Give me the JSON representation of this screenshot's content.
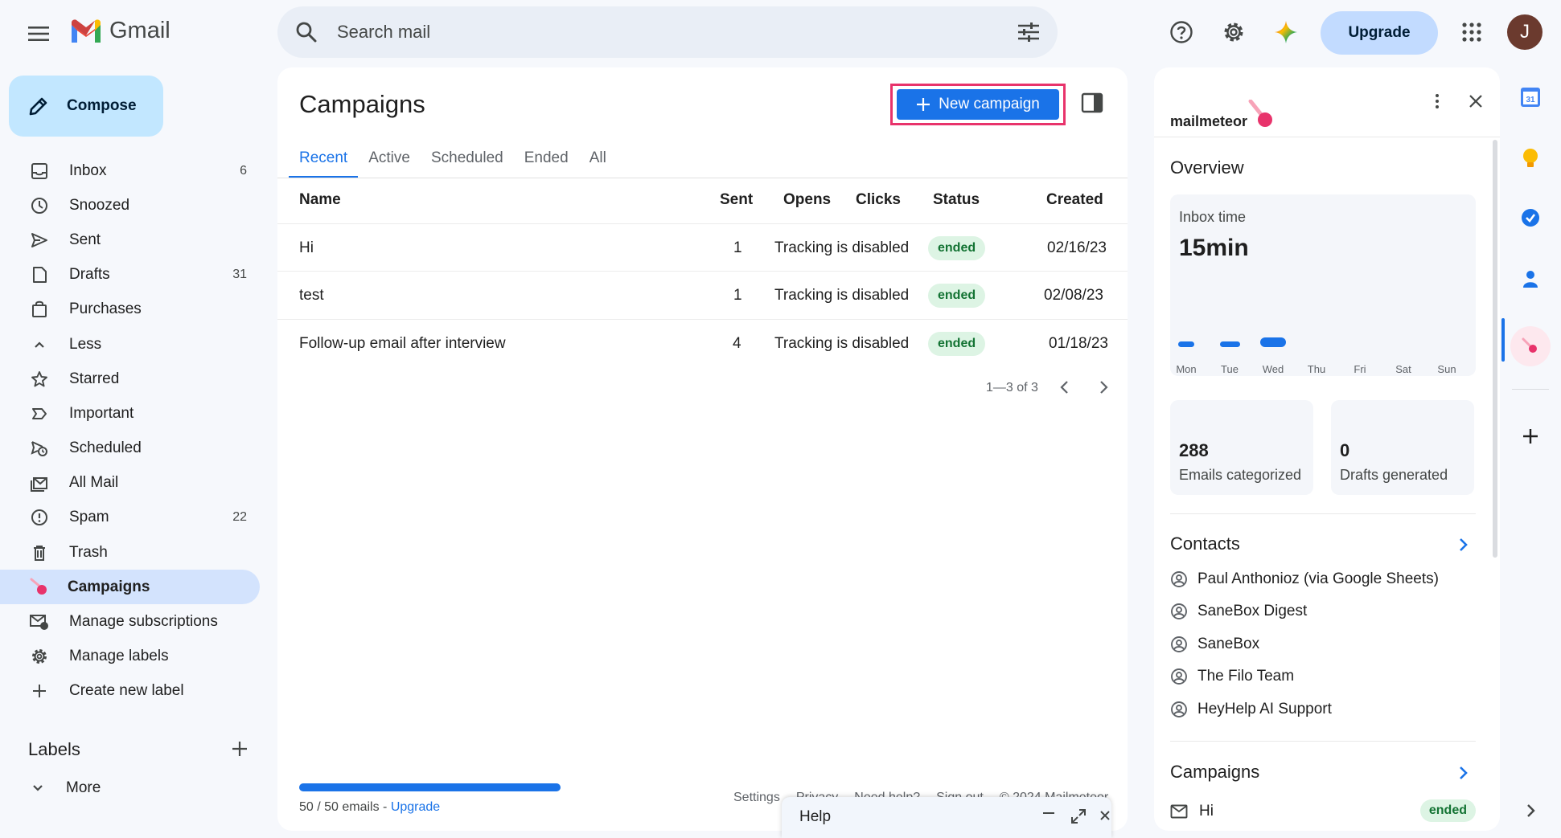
{
  "app": {
    "name": "Gmail",
    "search_placeholder": "Search mail",
    "upgrade_label": "Upgrade",
    "avatar_initial": "J"
  },
  "sidebar": {
    "compose_label": "Compose",
    "items": [
      {
        "label": "Inbox",
        "count": "6",
        "icon": "inbox-icon",
        "bold": true
      },
      {
        "label": "Snoozed",
        "count": "",
        "icon": "clock-icon",
        "bold": false
      },
      {
        "label": "Sent",
        "count": "",
        "icon": "send-icon",
        "bold": false
      },
      {
        "label": "Drafts",
        "count": "31",
        "icon": "draft-icon",
        "bold": true
      },
      {
        "label": "Purchases",
        "count": "",
        "icon": "shopping-bag-icon",
        "bold": false
      },
      {
        "label": "Less",
        "count": "",
        "icon": "chevron-up-icon",
        "bold": false
      },
      {
        "label": "Starred",
        "count": "",
        "icon": "star-icon",
        "bold": false
      },
      {
        "label": "Important",
        "count": "",
        "icon": "important-icon",
        "bold": false
      },
      {
        "label": "Scheduled",
        "count": "",
        "icon": "scheduled-send-icon",
        "bold": false
      },
      {
        "label": "All Mail",
        "count": "",
        "icon": "all-mail-icon",
        "bold": false
      },
      {
        "label": "Spam",
        "count": "22",
        "icon": "spam-icon",
        "bold": true
      },
      {
        "label": "Trash",
        "count": "",
        "icon": "trash-icon",
        "bold": false
      },
      {
        "label": "Campaigns",
        "count": "",
        "icon": "mailmeteor-icon",
        "bold": true
      },
      {
        "label": "Manage subscriptions",
        "count": "",
        "icon": "manage-subscriptions-icon",
        "bold": false
      },
      {
        "label": "Manage labels",
        "count": "",
        "icon": "gear-icon",
        "bold": false
      },
      {
        "label": "Create new label",
        "count": "",
        "icon": "plus-icon",
        "bold": false
      }
    ],
    "labels_heading": "Labels",
    "more_label": "More"
  },
  "main": {
    "title": "Campaigns",
    "new_campaign_label": "New campaign",
    "tabs": [
      "Recent",
      "Active",
      "Scheduled",
      "Ended",
      "All"
    ],
    "columns": {
      "name": "Name",
      "sent": "Sent",
      "opens": "Opens",
      "clicks": "Clicks",
      "status": "Status",
      "created": "Created"
    },
    "rows": [
      {
        "name": "Hi",
        "sent": "1",
        "tracking": "Tracking is disabled",
        "status": "ended",
        "created": "02/16/23"
      },
      {
        "name": "test",
        "sent": "1",
        "tracking": "Tracking is disabled",
        "status": "ended",
        "created": "02/08/23"
      },
      {
        "name": "Follow-up email after interview",
        "sent": "4",
        "tracking": "Tracking is disabled",
        "status": "ended",
        "created": "01/18/23"
      }
    ],
    "pagination": "1—3 of 3",
    "quota_text": "50 / 50 emails - ",
    "quota_link": "Upgrade",
    "quota_fraction": 1.0,
    "footer_links": [
      "Settings",
      "Privacy",
      "Need help?",
      "Sign out",
      "© 2024 Mailmeteor"
    ]
  },
  "help": {
    "title": "Help"
  },
  "right_panel": {
    "brand": "mailmeteor",
    "overview_title": "Overview",
    "inbox_time_label": "Inbox time",
    "inbox_time_value": "15min",
    "days": [
      "Mon",
      "Tue",
      "Wed",
      "Thu",
      "Fri",
      "Sat",
      "Sun"
    ],
    "day_levels": [
      0.55,
      0.7,
      0.9,
      0,
      0,
      0,
      0
    ],
    "emails_categorized_value": "288",
    "emails_categorized_label": "Emails categorized",
    "drafts_generated_value": "0",
    "drafts_generated_label": "Drafts generated",
    "contacts_title": "Contacts",
    "contacts": [
      "Paul Anthonioz (via Google Sheets)",
      "SaneBox Digest",
      "SaneBox",
      "The Filo Team",
      "HeyHelp AI Support"
    ],
    "campaigns_title": "Campaigns",
    "campaign_item": {
      "name": "Hi",
      "status": "ended"
    }
  },
  "colors": {
    "accent": "#1a73e8",
    "highlight": "#e8336b",
    "ended_bg": "#ddf4e4",
    "ended_fg": "#137333"
  }
}
